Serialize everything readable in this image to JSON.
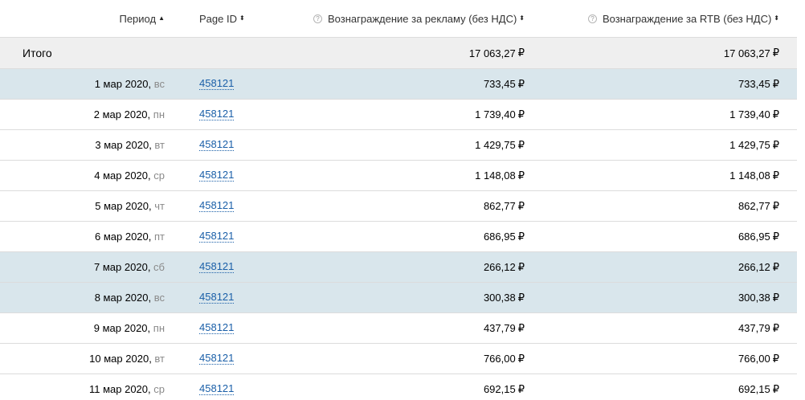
{
  "header": {
    "period": "Период",
    "period_sort": "▲",
    "page_id": "Page ID",
    "page_id_sort": "⬍",
    "ads_help": "?",
    "ads": "Вознаграждение за рекламу (без НДС)",
    "ads_sort": "⬍",
    "rtb_help": "?",
    "rtb": "Вознаграждение за RTB (без НДС)",
    "rtb_sort": "⬍"
  },
  "currency": "₽",
  "total": {
    "label": "Итого",
    "ads": "17 063,27",
    "rtb": "17 063,27"
  },
  "rows": [
    {
      "date": "1 мар 2020",
      "dow": "вс",
      "page_id": "458121",
      "ads": "733,45",
      "rtb": "733,45",
      "weekend": true
    },
    {
      "date": "2 мар 2020",
      "dow": "пн",
      "page_id": "458121",
      "ads": "1 739,40",
      "rtb": "1 739,40",
      "weekend": false
    },
    {
      "date": "3 мар 2020",
      "dow": "вт",
      "page_id": "458121",
      "ads": "1 429,75",
      "rtb": "1 429,75",
      "weekend": false
    },
    {
      "date": "4 мар 2020",
      "dow": "ср",
      "page_id": "458121",
      "ads": "1 148,08",
      "rtb": "1 148,08",
      "weekend": false
    },
    {
      "date": "5 мар 2020",
      "dow": "чт",
      "page_id": "458121",
      "ads": "862,77",
      "rtb": "862,77",
      "weekend": false
    },
    {
      "date": "6 мар 2020",
      "dow": "пт",
      "page_id": "458121",
      "ads": "686,95",
      "rtb": "686,95",
      "weekend": false
    },
    {
      "date": "7 мар 2020",
      "dow": "сб",
      "page_id": "458121",
      "ads": "266,12",
      "rtb": "266,12",
      "weekend": true
    },
    {
      "date": "8 мар 2020",
      "dow": "вс",
      "page_id": "458121",
      "ads": "300,38",
      "rtb": "300,38",
      "weekend": true
    },
    {
      "date": "9 мар 2020",
      "dow": "пн",
      "page_id": "458121",
      "ads": "437,79",
      "rtb": "437,79",
      "weekend": false
    },
    {
      "date": "10 мар 2020",
      "dow": "вт",
      "page_id": "458121",
      "ads": "766,00",
      "rtb": "766,00",
      "weekend": false
    },
    {
      "date": "11 мар 2020",
      "dow": "ср",
      "page_id": "458121",
      "ads": "692,15",
      "rtb": "692,15",
      "weekend": false
    }
  ]
}
